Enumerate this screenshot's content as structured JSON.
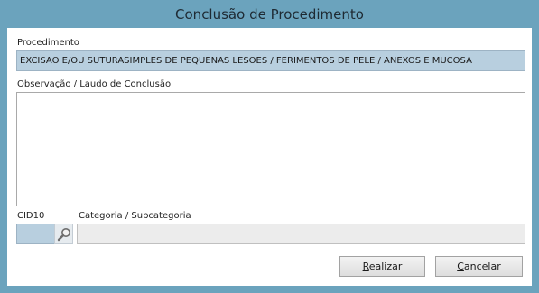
{
  "window": {
    "title": "Conclusão de Procedimento"
  },
  "procedimento": {
    "label": "Procedimento",
    "value": "EXCISAO E/OU SUTURASIMPLES DE PEQUENAS LESOES / FERIMENTOS DE PELE / ANEXOS E MUCOSA"
  },
  "observacao": {
    "label": "Observação / Laudo de Conclusão",
    "value": ""
  },
  "cid10": {
    "label": "CID10",
    "value": "",
    "search_icon": "magnifier-icon"
  },
  "categoria": {
    "label": "Categoria / Subcategoria",
    "value": ""
  },
  "buttons": {
    "realizar": "Realizar",
    "cancelar": "Cancelar"
  },
  "colors": {
    "frame": "#6ba3bd",
    "readonly_bg": "#b8cfdf",
    "disabled_bg": "#ececec"
  }
}
